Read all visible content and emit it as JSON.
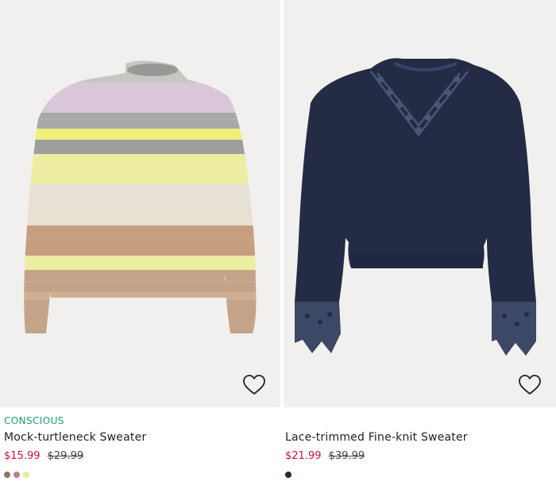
{
  "products": [
    {
      "tag": "CONSCIOUS",
      "name": "Mock-turtleneck Sweater",
      "price_sale": "$15.99",
      "price_original": "$29.99",
      "swatches": [
        "#8b7766",
        "#c27ba0",
        "#e9ec94"
      ]
    },
    {
      "tag": "",
      "name": "Lace-trimmed Fine-knit Sweater",
      "price_sale": "$21.99",
      "price_original": "$39.99",
      "swatches": [
        "#1f2a44"
      ]
    }
  ],
  "icons": {
    "favorite": "heart-outline-icon"
  },
  "colors": {
    "sale_price": "#d0103a",
    "conscious_tag": "#1b9e77",
    "image_bg": "#f1f0ee"
  }
}
